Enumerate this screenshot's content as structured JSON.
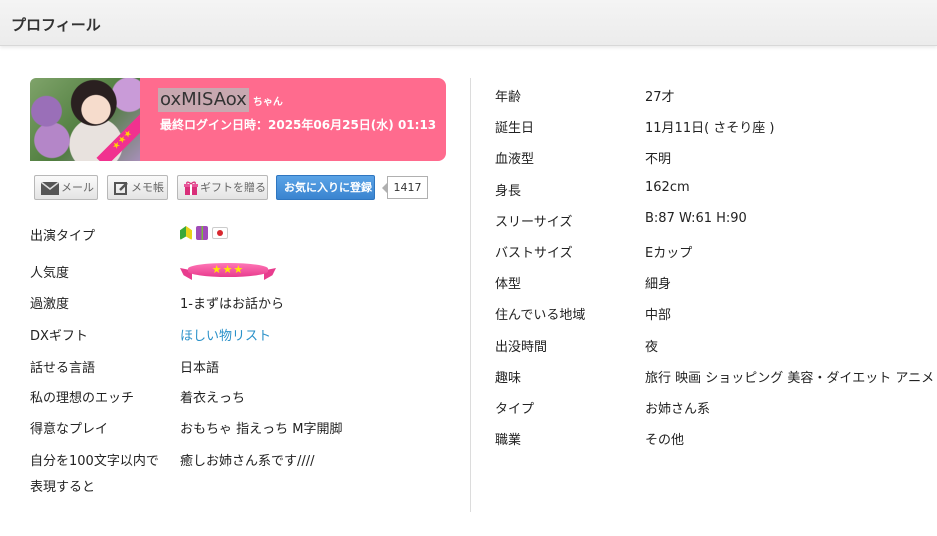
{
  "header": {
    "title": "プロフィール"
  },
  "profile": {
    "name": "oxMISAox",
    "honorific": "ちゃん",
    "last_login": "最終ログイン日時：2025年06月25日(水) 01:13",
    "avatar_ribbon": "★★★",
    "accent_color": "#ff6b8e"
  },
  "actions": {
    "mail_label": "メール",
    "memo_label": "メモ帳",
    "gift_label": "ギフトを贈る",
    "favorite_label": "お気に入りに登録",
    "favorite_count": "1417"
  },
  "left_details": {
    "type": {
      "label": "出演タイプ",
      "icons": [
        "beginner-leaf-icon",
        "bottle-icon",
        "japan-flag-icon"
      ]
    },
    "popularity": {
      "label": "人気度",
      "stars": "★★★",
      "rating": 3
    },
    "intensity": {
      "label": "過激度",
      "value": "1-まずはお話から"
    },
    "dx_gift": {
      "label": "DXギフト",
      "value": "ほしい物リスト"
    },
    "language": {
      "label": "話せる言語",
      "value": "日本語"
    },
    "ideal": {
      "label": "私の理想のエッチ",
      "value": "着衣えっち"
    },
    "play": {
      "label": "得意なプレイ",
      "value": "おもちゃ 指えっち M字開脚"
    },
    "self_intro": {
      "label_line1": "自分を100文字以内で",
      "label_line2": "表現すると",
      "value": "癒しお姉さん系です////"
    }
  },
  "right_details": [
    {
      "label": "年齢",
      "value": "27才"
    },
    {
      "label": "誕生日",
      "value": "11月11日( さそり座 )"
    },
    {
      "label": "血液型",
      "value": "不明"
    },
    {
      "label": "身長",
      "value": "162cm"
    },
    {
      "label": "スリーサイズ",
      "value": "B:87 W:61 H:90"
    },
    {
      "label": "バストサイズ",
      "value": "Eカップ"
    },
    {
      "label": "体型",
      "value": "細身"
    },
    {
      "label": "住んでいる地域",
      "value": "中部"
    },
    {
      "label": "出没時間",
      "value": "夜"
    },
    {
      "label": "趣味",
      "value": "旅行 映画 ショッピング 美容・ダイエット アニメ"
    },
    {
      "label": "タイプ",
      "value": "お姉さん系"
    },
    {
      "label": "職業",
      "value": "その他"
    }
  ]
}
